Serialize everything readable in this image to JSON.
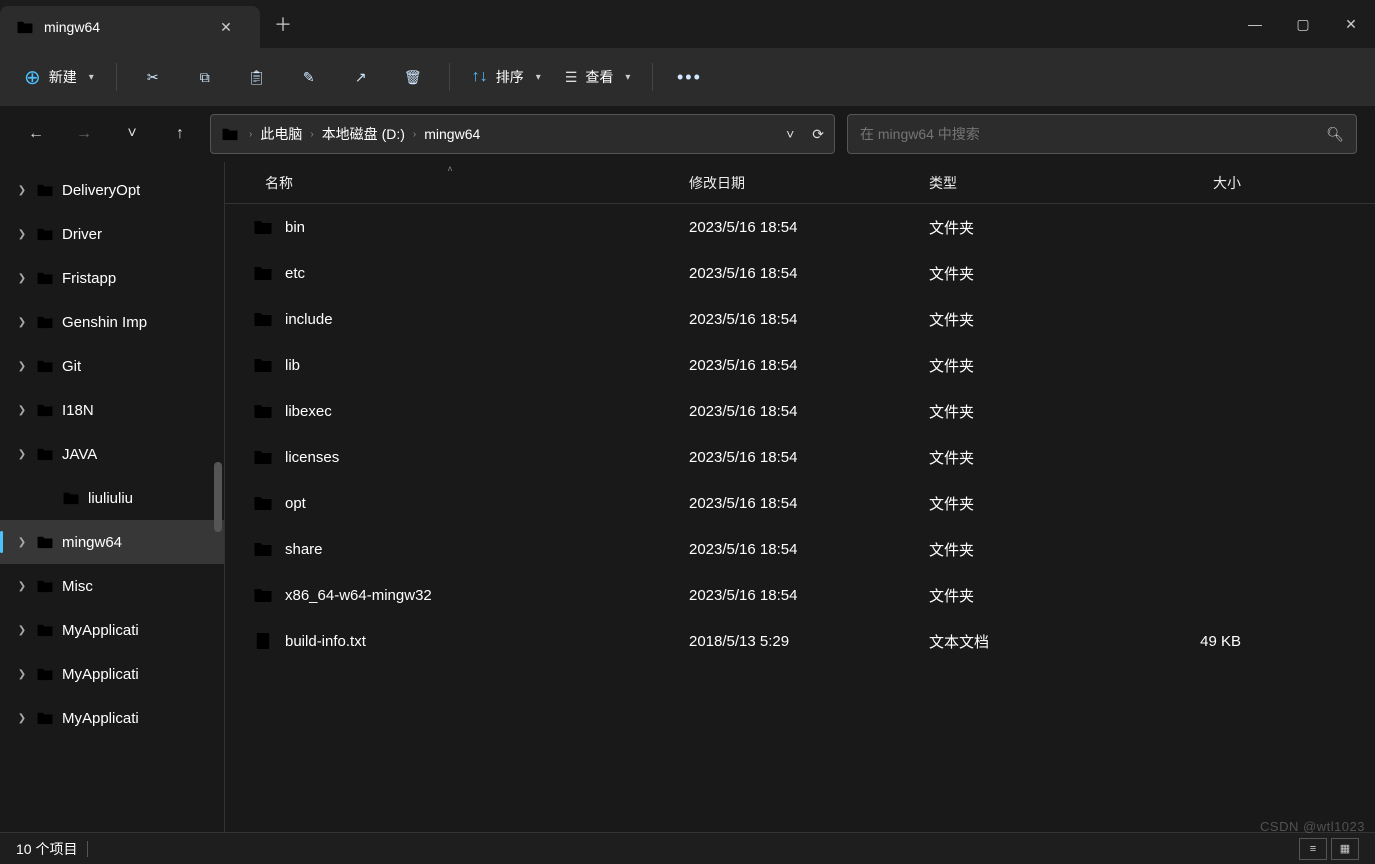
{
  "tab": {
    "title": "mingw64"
  },
  "toolbar": {
    "new": "新建",
    "sort": "排序",
    "view": "查看"
  },
  "breadcrumbs": [
    "此电脑",
    "本地磁盘 (D:)",
    "mingw64"
  ],
  "search": {
    "placeholder": "在 mingw64 中搜索"
  },
  "tree": [
    {
      "name": "DeliveryOpt",
      "exp": true,
      "indent": false
    },
    {
      "name": "Driver",
      "exp": true,
      "indent": false
    },
    {
      "name": "Fristapp",
      "exp": true,
      "indent": false
    },
    {
      "name": "Genshin Imp",
      "exp": true,
      "indent": false
    },
    {
      "name": "Git",
      "exp": true,
      "indent": false
    },
    {
      "name": "I18N",
      "exp": true,
      "indent": false
    },
    {
      "name": "JAVA",
      "exp": true,
      "indent": false
    },
    {
      "name": "liuliuliu",
      "exp": false,
      "indent": true
    },
    {
      "name": "mingw64",
      "exp": true,
      "indent": false,
      "selected": true
    },
    {
      "name": "Misc",
      "exp": true,
      "indent": false
    },
    {
      "name": "MyApplicati",
      "exp": true,
      "indent": false
    },
    {
      "name": "MyApplicati",
      "exp": true,
      "indent": false
    },
    {
      "name": "MyApplicati",
      "exp": true,
      "indent": false
    }
  ],
  "columns": {
    "name": "名称",
    "date": "修改日期",
    "type": "类型",
    "size": "大小"
  },
  "rows": [
    {
      "icon": "folder",
      "name": "bin",
      "date": "2023/5/16 18:54",
      "type": "文件夹",
      "size": ""
    },
    {
      "icon": "folder",
      "name": "etc",
      "date": "2023/5/16 18:54",
      "type": "文件夹",
      "size": ""
    },
    {
      "icon": "folder",
      "name": "include",
      "date": "2023/5/16 18:54",
      "type": "文件夹",
      "size": ""
    },
    {
      "icon": "folder",
      "name": "lib",
      "date": "2023/5/16 18:54",
      "type": "文件夹",
      "size": ""
    },
    {
      "icon": "folder",
      "name": "libexec",
      "date": "2023/5/16 18:54",
      "type": "文件夹",
      "size": ""
    },
    {
      "icon": "folder",
      "name": "licenses",
      "date": "2023/5/16 18:54",
      "type": "文件夹",
      "size": ""
    },
    {
      "icon": "folder",
      "name": "opt",
      "date": "2023/5/16 18:54",
      "type": "文件夹",
      "size": ""
    },
    {
      "icon": "folder",
      "name": "share",
      "date": "2023/5/16 18:54",
      "type": "文件夹",
      "size": ""
    },
    {
      "icon": "folder",
      "name": "x86_64-w64-mingw32",
      "date": "2023/5/16 18:54",
      "type": "文件夹",
      "size": ""
    },
    {
      "icon": "txt",
      "name": "build-info.txt",
      "date": "2018/5/13 5:29",
      "type": "文本文档",
      "size": "49 KB"
    }
  ],
  "status": {
    "count": "10 个项目"
  },
  "watermark": "CSDN @wtl1023"
}
